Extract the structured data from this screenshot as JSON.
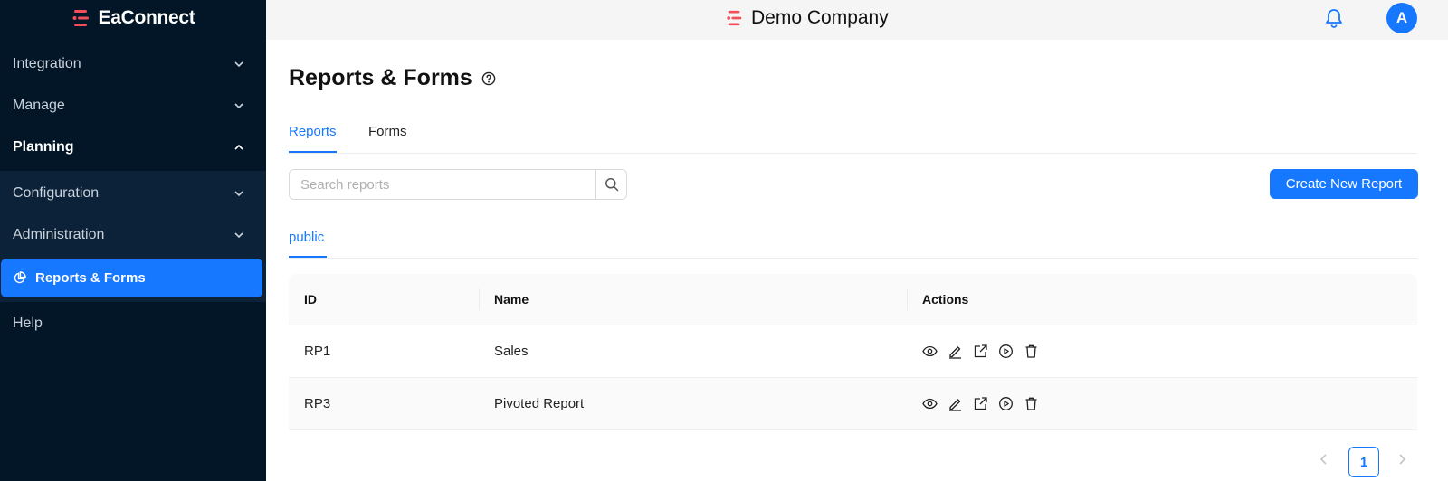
{
  "sidebar": {
    "brand": "EaConnect",
    "items": [
      {
        "label": "Integration"
      },
      {
        "label": "Manage"
      },
      {
        "label": "Planning"
      },
      {
        "label": "Configuration"
      },
      {
        "label": "Administration"
      },
      {
        "label": "Reports & Forms"
      },
      {
        "label": "Help"
      }
    ]
  },
  "header": {
    "company": "Demo Company",
    "avatar_initial": "A"
  },
  "main": {
    "title": "Reports & Forms",
    "tabs": [
      {
        "label": "Reports"
      },
      {
        "label": "Forms"
      }
    ],
    "search": {
      "placeholder": "Search reports",
      "value": ""
    },
    "create_label": "Create New Report",
    "subtab": "public",
    "table": {
      "headers": [
        "ID",
        "Name",
        "Actions"
      ],
      "rows": [
        {
          "id": "RP1",
          "name": "Sales"
        },
        {
          "id": "RP3",
          "name": "Pivoted Report"
        }
      ]
    },
    "pagination": {
      "current": "1"
    }
  },
  "colors": {
    "accent": "#1677ff",
    "sidebar_bg": "#031628",
    "brand_logo": "#f0505a"
  }
}
